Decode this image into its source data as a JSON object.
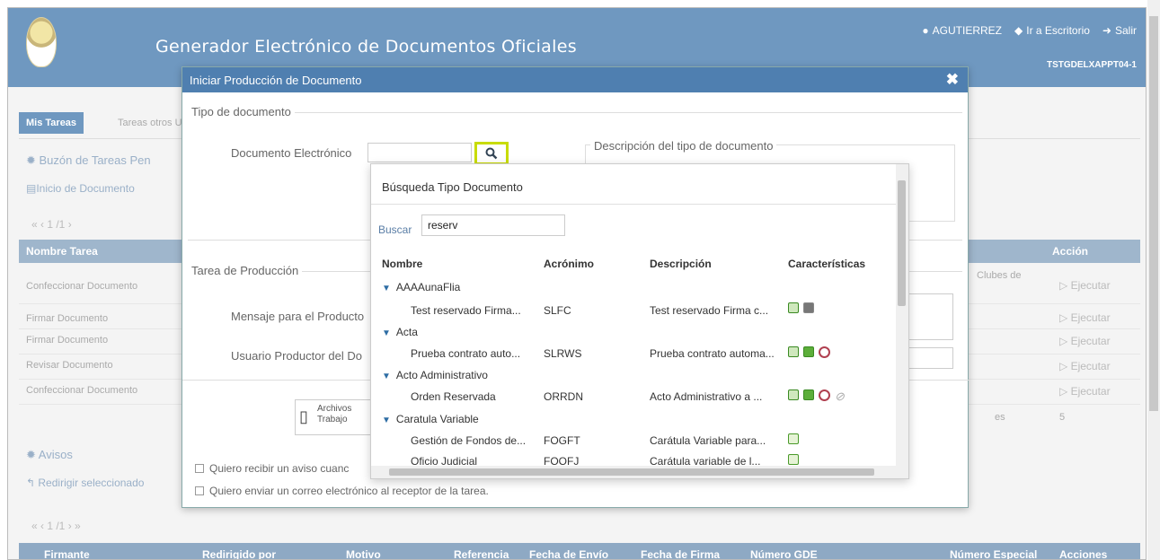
{
  "header": {
    "title": "Generador Electrónico de Documentos Oficiales",
    "user": "AGUTIERREZ",
    "desktop_link": "Ir a Escritorio",
    "logout": "Salir",
    "server": "TSTGDELXAPPT04-1",
    "brand_color": "#6f98c0"
  },
  "background": {
    "tab_active": "Mis Tareas",
    "tab_other": "Tareas otros U",
    "buzon": "Buzón de Tareas Pen",
    "inicio": "Inicio de Documento",
    "pager": "« ‹ 1 /1 ›",
    "col_nombre": "Nombre Tarea",
    "col_accion": "Acción",
    "rows": [
      {
        "name": "Confeccionar Documento",
        "extra": "Clubes de",
        "action": "▷ Ejecutar"
      },
      {
        "name": "Firmar Documento",
        "action": "▷ Ejecutar"
      },
      {
        "name": "Firmar Documento",
        "action": "▷ Ejecutar"
      },
      {
        "name": "Revisar Documento",
        "action": "▷ Ejecutar"
      },
      {
        "name": "Confeccionar Documento",
        "action": "▷ Ejecutar"
      }
    ],
    "count_suffix": "es",
    "count": "5",
    "avisos": "Avisos",
    "redirigir": "Redirigir seleccionado",
    "pager2": "« ‹ 1 /1 › »",
    "bottom_cols": [
      "Firmante",
      "Redirigido por",
      "Motivo",
      "Referencia",
      "Fecha de Envío",
      "Fecha de Firma",
      "Número GDE",
      "Número Especial",
      "Acciones"
    ]
  },
  "modal": {
    "title": "Iniciar Producción de Documento",
    "close": "✖",
    "tipo_legend": "Tipo de documento",
    "doc_label": "Documento Electrónico",
    "desc_legend": "Descripción del tipo de documento",
    "tarea_legend": "Tarea de Producción",
    "mensaje_label": "Mensaje para el Producto",
    "usuario_label": "Usuario Productor del Do",
    "archivos_label": "Archivos",
    "trabajo_label": "Trabajo",
    "check1": "Quiero recibir un aviso cuanc",
    "check2": "Quiero enviar un correo electrónico al receptor de la tarea."
  },
  "popup": {
    "title": "Búsqueda Tipo Documento",
    "search_label": "Buscar",
    "search_value": "reserv",
    "columns": {
      "nombre": "Nombre",
      "acronimo": "Acrónimo",
      "descripcion": "Descripción",
      "caracteristicas": "Características"
    },
    "groups": [
      {
        "name": "AAAAunaFlia",
        "items": [
          {
            "nombre": "Test reservado Firma...",
            "acronimo": "SLFC",
            "descripcion": "Test reservado Firma c...",
            "icons": [
              "doc-green-icon",
              "firma-icon"
            ]
          }
        ]
      },
      {
        "name": "Acta",
        "items": [
          {
            "nombre": "Prueba contrato auto...",
            "acronimo": "SLRWS",
            "descripcion": "Prueba contrato automa...",
            "icons": [
              "doc-green-icon",
              "e-green-icon",
              "reserved-icon"
            ]
          }
        ]
      },
      {
        "name": "Acto Administrativo",
        "items": [
          {
            "nombre": "Orden Reservada",
            "acronimo": "ORRDN",
            "descripcion": "Acto Administrativo a ...",
            "icons": [
              "doc-green-icon",
              "e-green-icon",
              "reserved-icon",
              "attach-icon"
            ]
          }
        ]
      },
      {
        "name": "Caratula Variable",
        "items": [
          {
            "nombre": "Gestión de Fondos de...",
            "acronimo": "FOGFT",
            "descripcion": "Carátula Variable para...",
            "icons": [
              "t-green-icon"
            ]
          },
          {
            "nombre": "Oficio Judicial",
            "acronimo": "FOOFJ",
            "descripcion": "Carátula variable de l...",
            "icons": [
              "t-green-icon"
            ]
          }
        ]
      }
    ]
  }
}
